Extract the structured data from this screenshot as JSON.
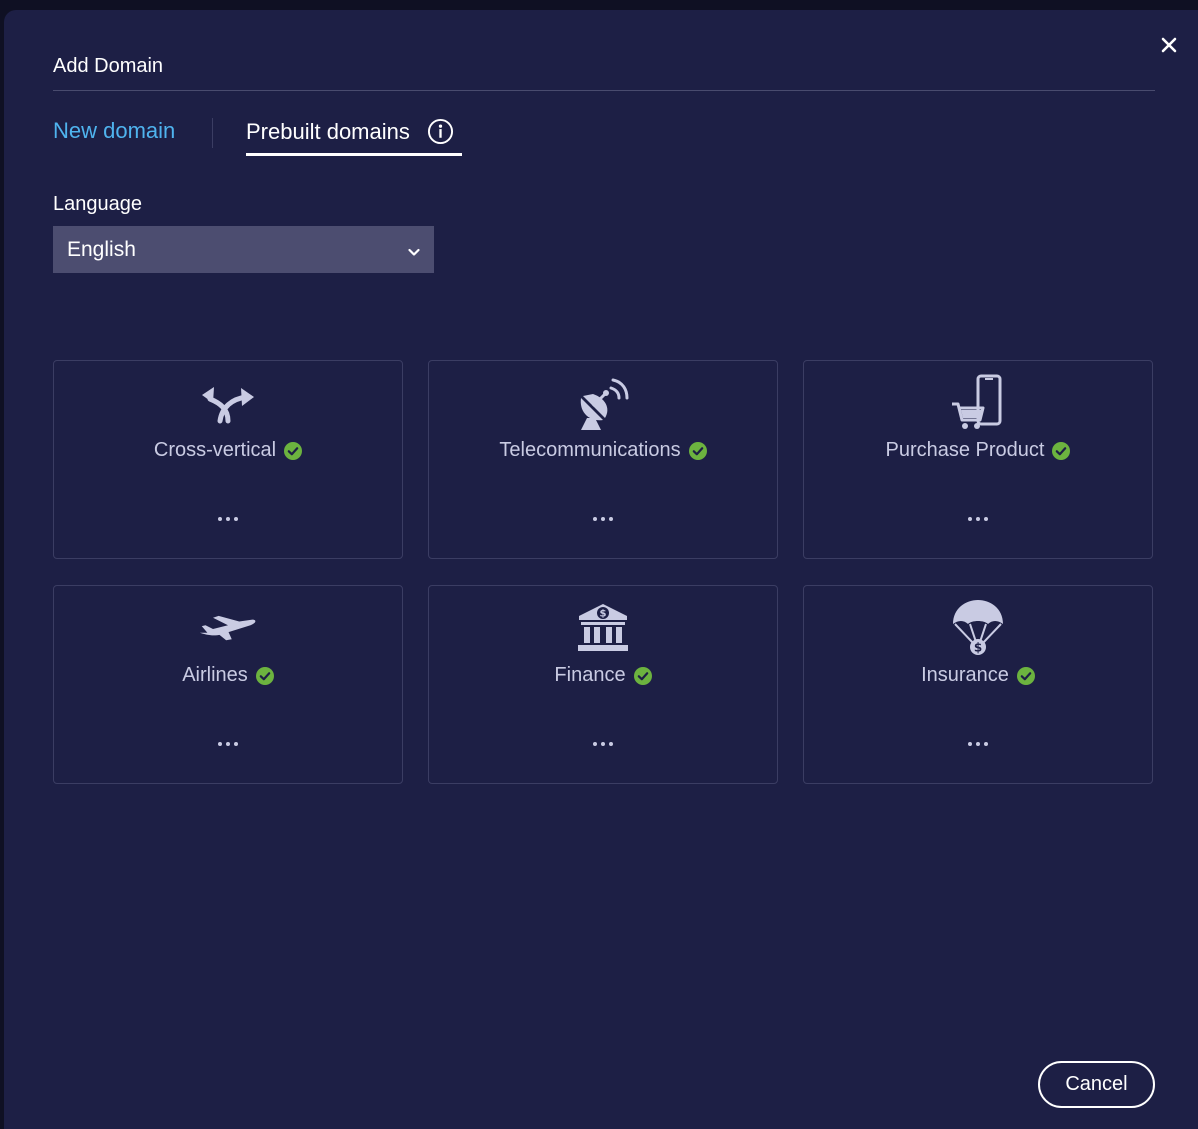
{
  "dialog": {
    "title": "Add Domain",
    "close_icon": "close-icon"
  },
  "tabs": [
    {
      "label": "New domain",
      "active": false
    },
    {
      "label": "Prebuilt domains",
      "active": true,
      "icon": "info-icon"
    }
  ],
  "language": {
    "label": "Language",
    "selected": "English",
    "icon": "chevron-down-icon"
  },
  "domains": [
    {
      "label": "Cross-vertical",
      "icon": "split-arrows-icon",
      "status": "check-circle-icon",
      "menu_icon": "more-icon"
    },
    {
      "label": "Telecommunications",
      "icon": "satellite-dish-icon",
      "status": "check-circle-icon",
      "menu_icon": "more-icon"
    },
    {
      "label": "Purchase Product",
      "icon": "phone-cart-icon",
      "status": "check-circle-icon",
      "menu_icon": "more-icon"
    },
    {
      "label": "Airlines",
      "icon": "airplane-icon",
      "status": "check-circle-icon",
      "menu_icon": "more-icon"
    },
    {
      "label": "Finance",
      "icon": "bank-icon",
      "status": "check-circle-icon",
      "menu_icon": "more-icon"
    },
    {
      "label": "Insurance",
      "icon": "parachute-money-icon",
      "status": "check-circle-icon",
      "menu_icon": "more-icon"
    }
  ],
  "footer": {
    "cancel_label": "Cancel"
  },
  "colors": {
    "background": "#1d1f45",
    "accent_link": "#4fb3ee",
    "check_green": "#6cb33f",
    "icon_gray": "#c9cbe3"
  }
}
